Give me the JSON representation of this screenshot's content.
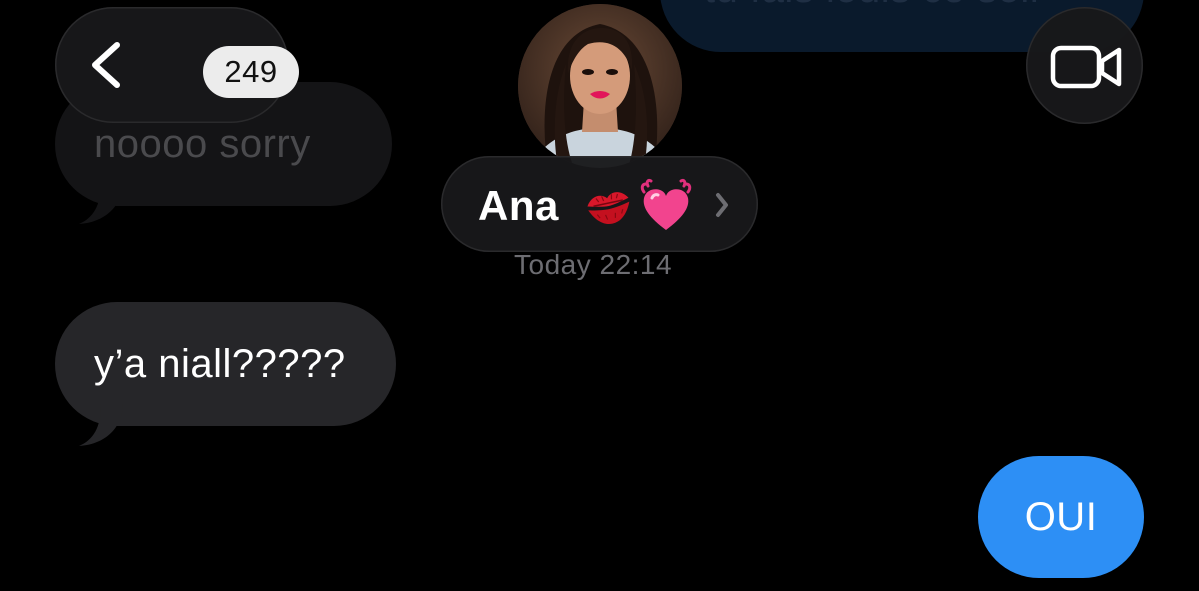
{
  "header": {
    "unread_count": "249",
    "contact_name": "Ana",
    "contact_emojis": [
      "kiss-mark",
      "beating-heart"
    ],
    "timestamp": "Today 22:14"
  },
  "messages": [
    {
      "direction": "outgoing",
      "text": "tu fais louis ce soir",
      "state": "scrolled-under-header"
    },
    {
      "direction": "incoming",
      "text": "noooo sorry",
      "state": "scrolled-under-header"
    },
    {
      "direction": "incoming",
      "text": "y’a niall?????"
    },
    {
      "direction": "outgoing",
      "text": "OUI"
    }
  ],
  "colors": {
    "background": "#000000",
    "incoming_bubble": "#262629",
    "outgoing_bubble": "#2d8ff5",
    "timestamp_text": "#6d6d72"
  },
  "icons": {
    "back": "chevron-left-icon",
    "video": "video-camera-icon",
    "pill_chevron": "chevron-right-icon"
  }
}
